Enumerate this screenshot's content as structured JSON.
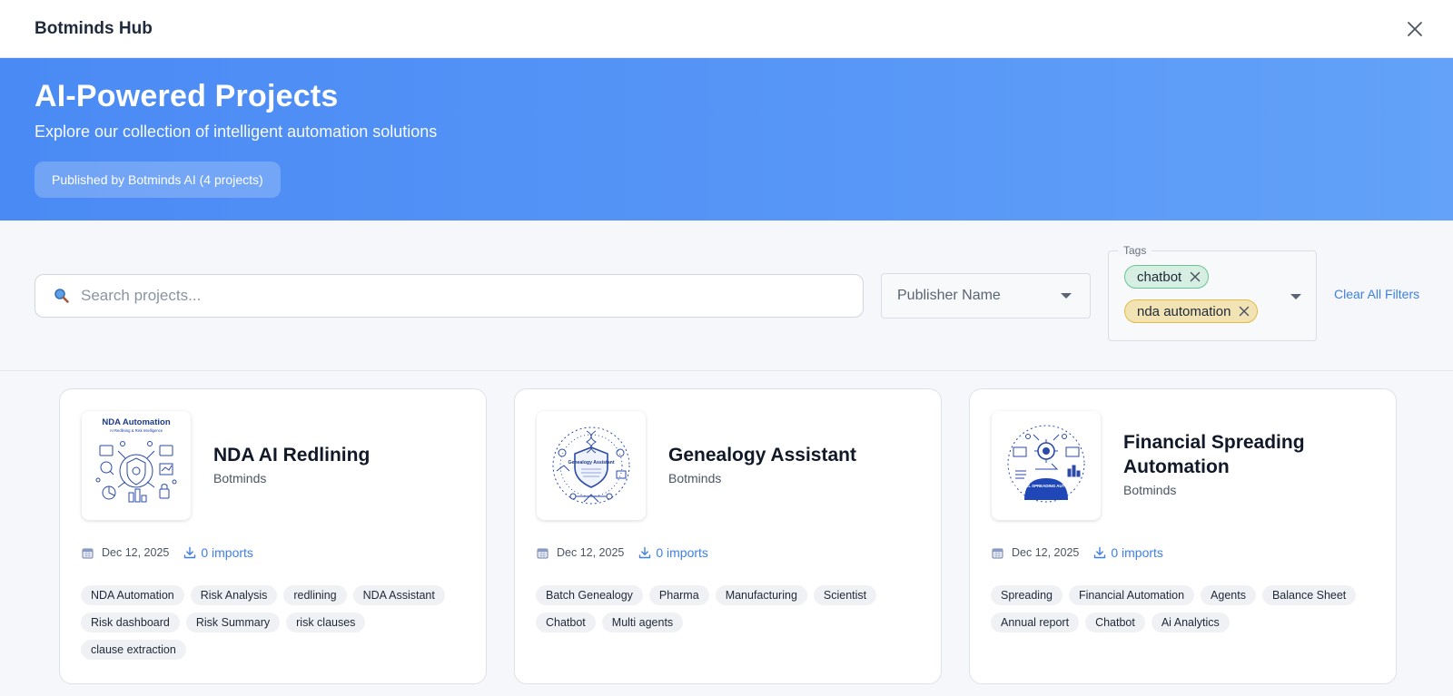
{
  "window": {
    "title": "Botminds Hub"
  },
  "hero": {
    "title": "AI-Powered Projects",
    "subtitle": "Explore our collection of intelligent automation solutions",
    "publisher_badge": "Published by Botminds AI (4 projects)"
  },
  "filters": {
    "search_placeholder": "Search projects...",
    "publisher_placeholder": "Publisher Name",
    "tags_label": "Tags",
    "selected_tags": [
      "chatbot",
      "nda automation"
    ],
    "clear_all": "Clear All Filters"
  },
  "colors": {
    "accent": "#3f7fe0",
    "hero_gradient_start": "#4a8af4",
    "hero_gradient_end": "#63a2f8",
    "chip_green": "#d6efe2",
    "chip_yellow": "#f2e3b5"
  },
  "projects": [
    {
      "title": "NDA AI Redlining",
      "publisher": "Botminds",
      "date": "Dec 12, 2025",
      "imports": "0 imports",
      "thumb_heading": "NDA Automation",
      "thumb_subheading": "AI Redlining & Risk Intelligence",
      "tags": [
        "NDA Automation",
        "Risk Analysis",
        "redlining",
        "NDA Assistant",
        "Risk dashboard",
        "Risk Summary",
        "risk clauses",
        "clause extraction"
      ]
    },
    {
      "title": "Genealogy Assistant",
      "publisher": "Botminds",
      "date": "Dec 12, 2025",
      "imports": "0 imports",
      "thumb_heading": "Genealogy Assistant",
      "tags": [
        "Batch Genealogy",
        "Pharma",
        "Manufacturing",
        "Scientist",
        "Chatbot",
        "Multi agents"
      ]
    },
    {
      "title": "Financial Spreading Automation",
      "publisher": "Botminds",
      "date": "Dec 12, 2025",
      "imports": "0 imports",
      "thumb_heading": "FINANCIAL SPREADING AUTOMATION",
      "tags": [
        "Spreading",
        "Financial Automation",
        "Agents",
        "Balance Sheet",
        "Annual report",
        "Chatbot",
        "Ai Analytics"
      ]
    }
  ]
}
